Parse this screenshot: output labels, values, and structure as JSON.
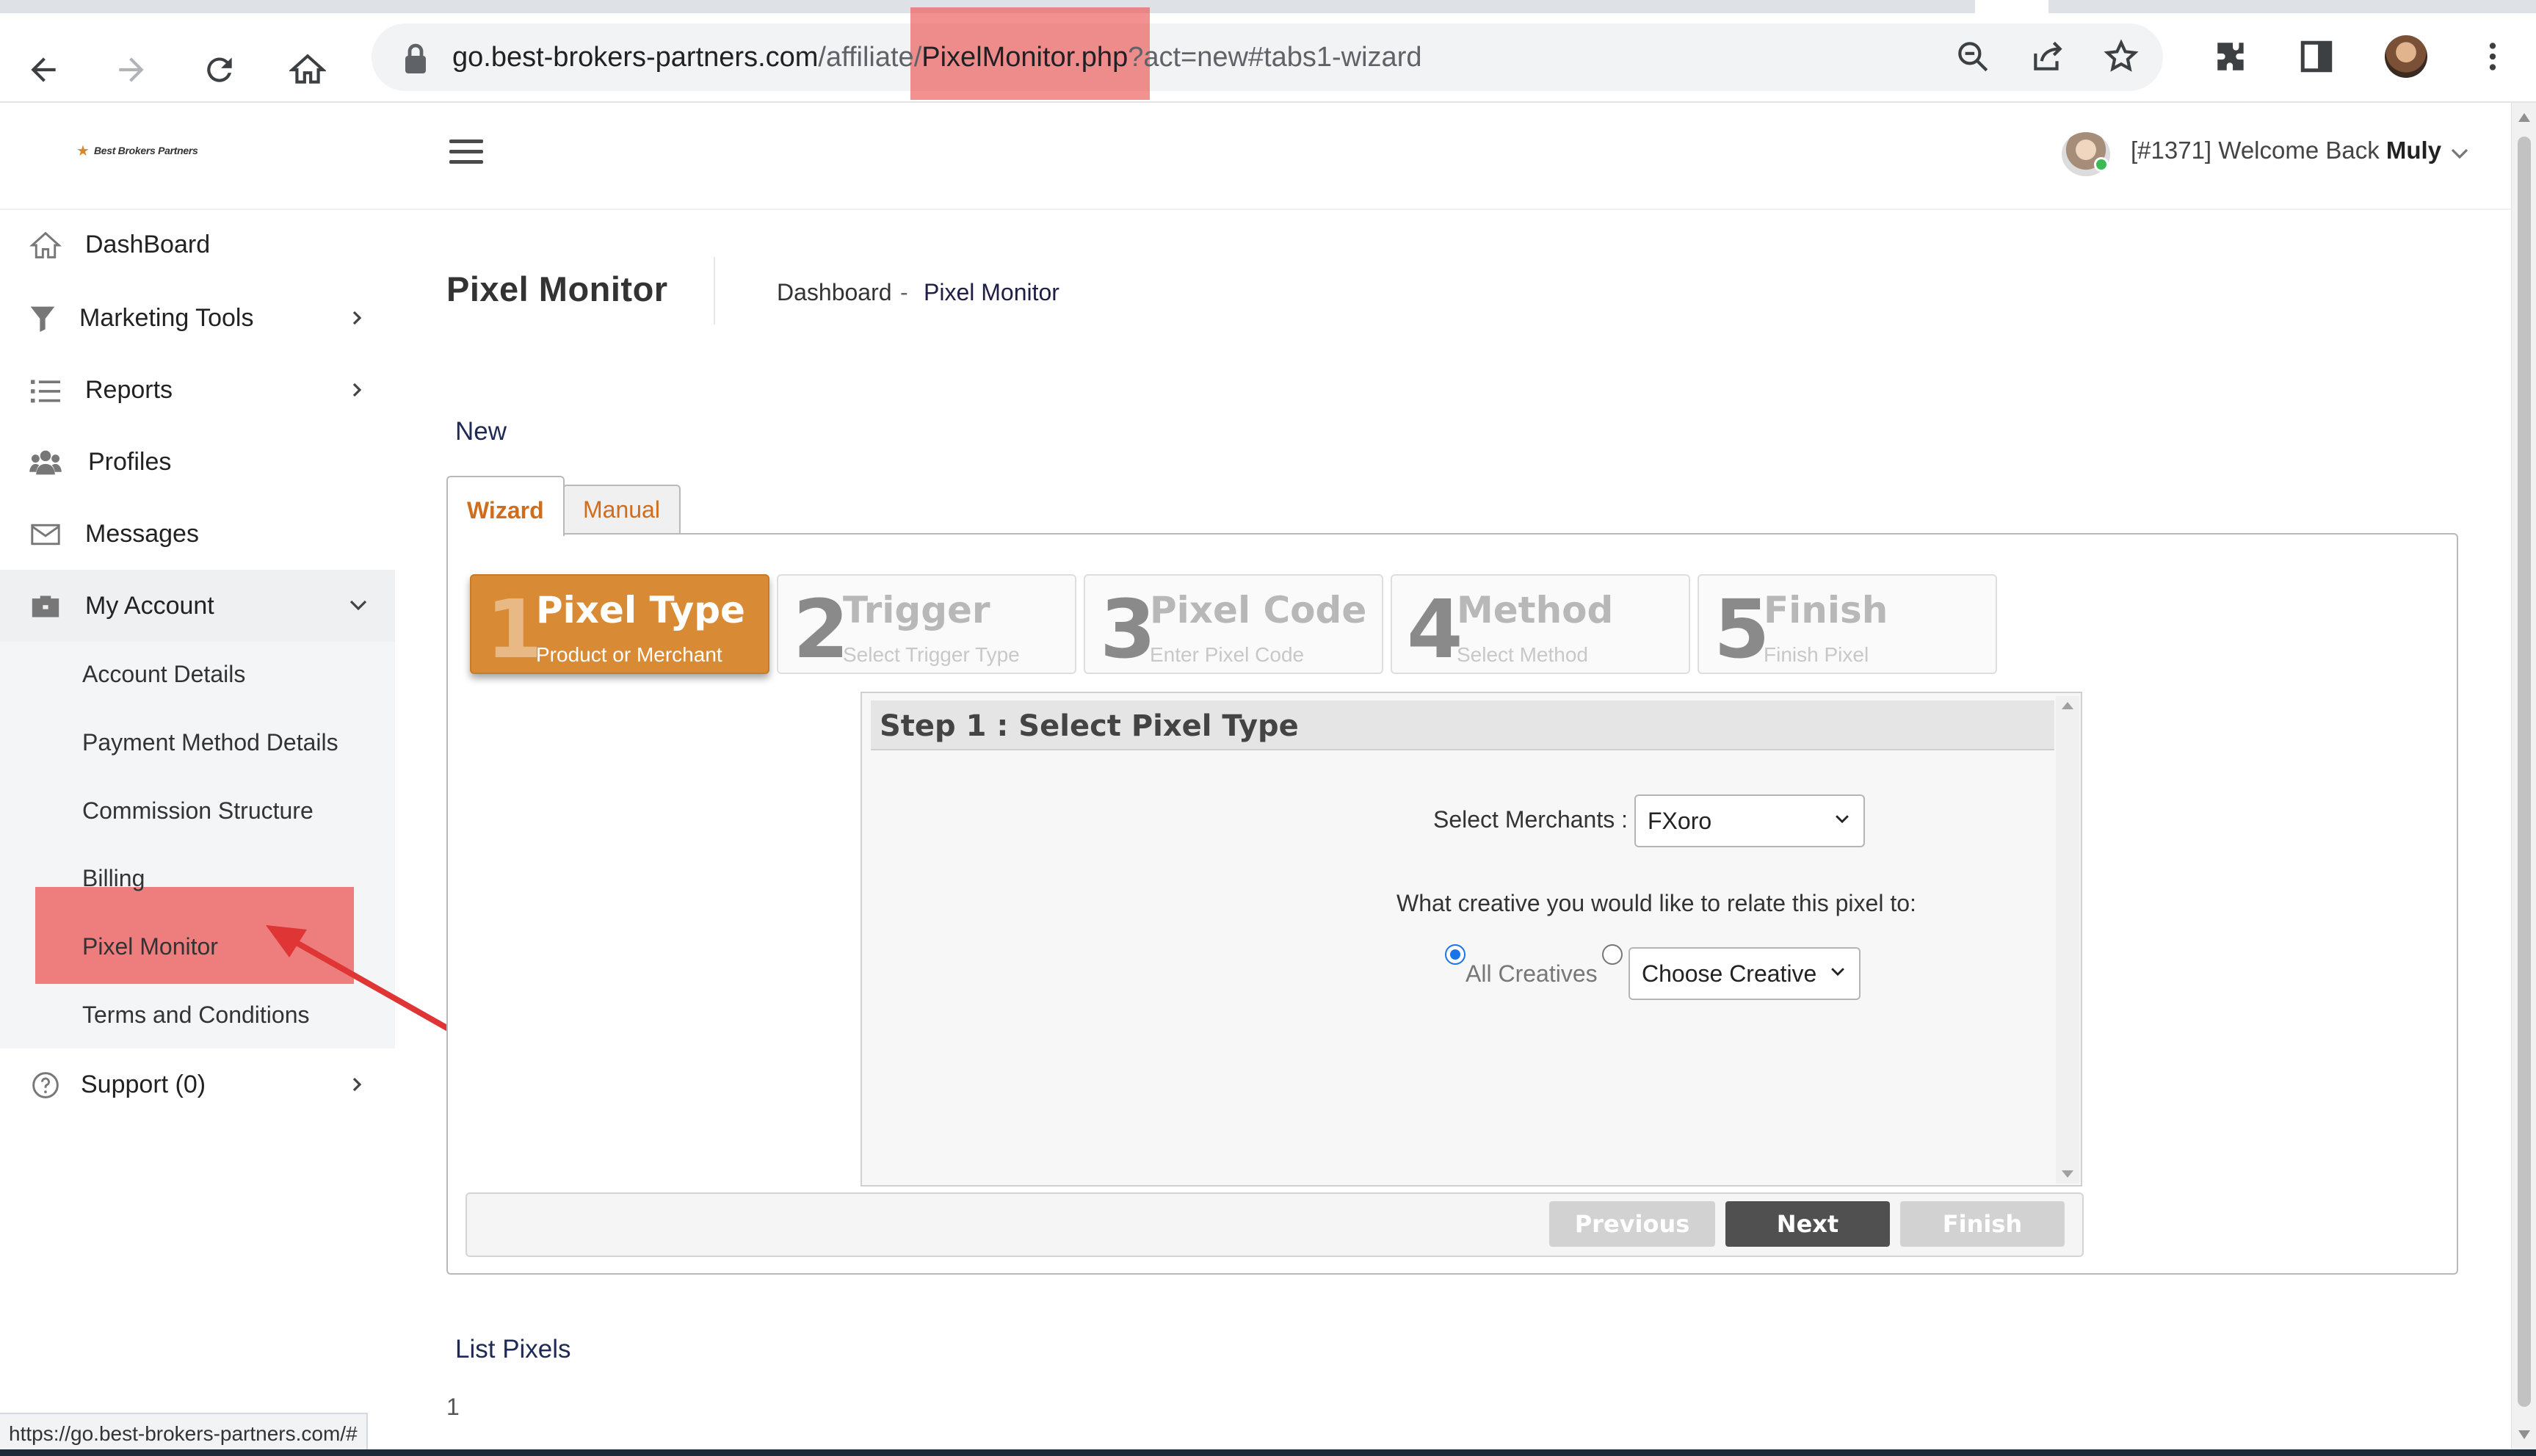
{
  "browser": {
    "url_host": "go.best-brokers-partners.com",
    "url_path_prefix": "/affiliate/",
    "url_file": "PixelMonitor.php",
    "url_query": "?act=new#tabs1-wizard",
    "status_url": "https://go.best-brokers-partners.com/#"
  },
  "header": {
    "logo_text": "Best Brokers Partners",
    "welcome_prefix": "[#1371] Welcome Back ",
    "user_name": "Muly"
  },
  "sidebar": {
    "items": [
      {
        "label": "DashBoard",
        "icon": "home-icon"
      },
      {
        "label": "Marketing Tools",
        "icon": "filter-icon"
      },
      {
        "label": "Reports",
        "icon": "list-icon"
      },
      {
        "label": "Profiles",
        "icon": "users-icon"
      },
      {
        "label": "Messages",
        "icon": "envelope-icon"
      },
      {
        "label": "My Account",
        "icon": "briefcase-icon"
      },
      {
        "label": "Support (0)",
        "icon": "question-circle-icon"
      }
    ],
    "submenu": [
      "Account Details",
      "Payment Method Details",
      "Commission Structure",
      "Billing",
      "Pixel Monitor",
      "Terms and Conditions"
    ]
  },
  "page": {
    "title": "Pixel Monitor",
    "breadcrumb": [
      "Dashboard",
      "-",
      "Pixel Monitor"
    ],
    "section_new": "New",
    "tabs": [
      "Wizard",
      "Manual"
    ],
    "steps": [
      {
        "num": "1",
        "title": "Pixel Type",
        "subtitle": "Product or Merchant"
      },
      {
        "num": "2",
        "title": "Trigger",
        "subtitle": "Select Trigger Type"
      },
      {
        "num": "3",
        "title": "Pixel Code",
        "subtitle": "Enter Pixel Code"
      },
      {
        "num": "4",
        "title": "Method",
        "subtitle": "Select Method"
      },
      {
        "num": "5",
        "title": "Finish",
        "subtitle": "Finish Pixel"
      }
    ],
    "step_title": "Step 1 : Select Pixel Type",
    "merchants_label": "Select Merchants :",
    "merchant_value": "FXoro",
    "creative_question": "What creative you would like to relate this pixel to:",
    "all_creatives_label": "All Creatives",
    "choose_creative_value": "Choose Creative",
    "buttons": {
      "previous": "Previous",
      "next": "Next",
      "finish": "Finish"
    },
    "list_title": "List Pixels",
    "list_count": "1"
  },
  "colors": {
    "accent_orange": "#d98a35",
    "link_orange": "#d06d1c",
    "highlight_red": "#ec5555",
    "next_button": "#505050"
  }
}
